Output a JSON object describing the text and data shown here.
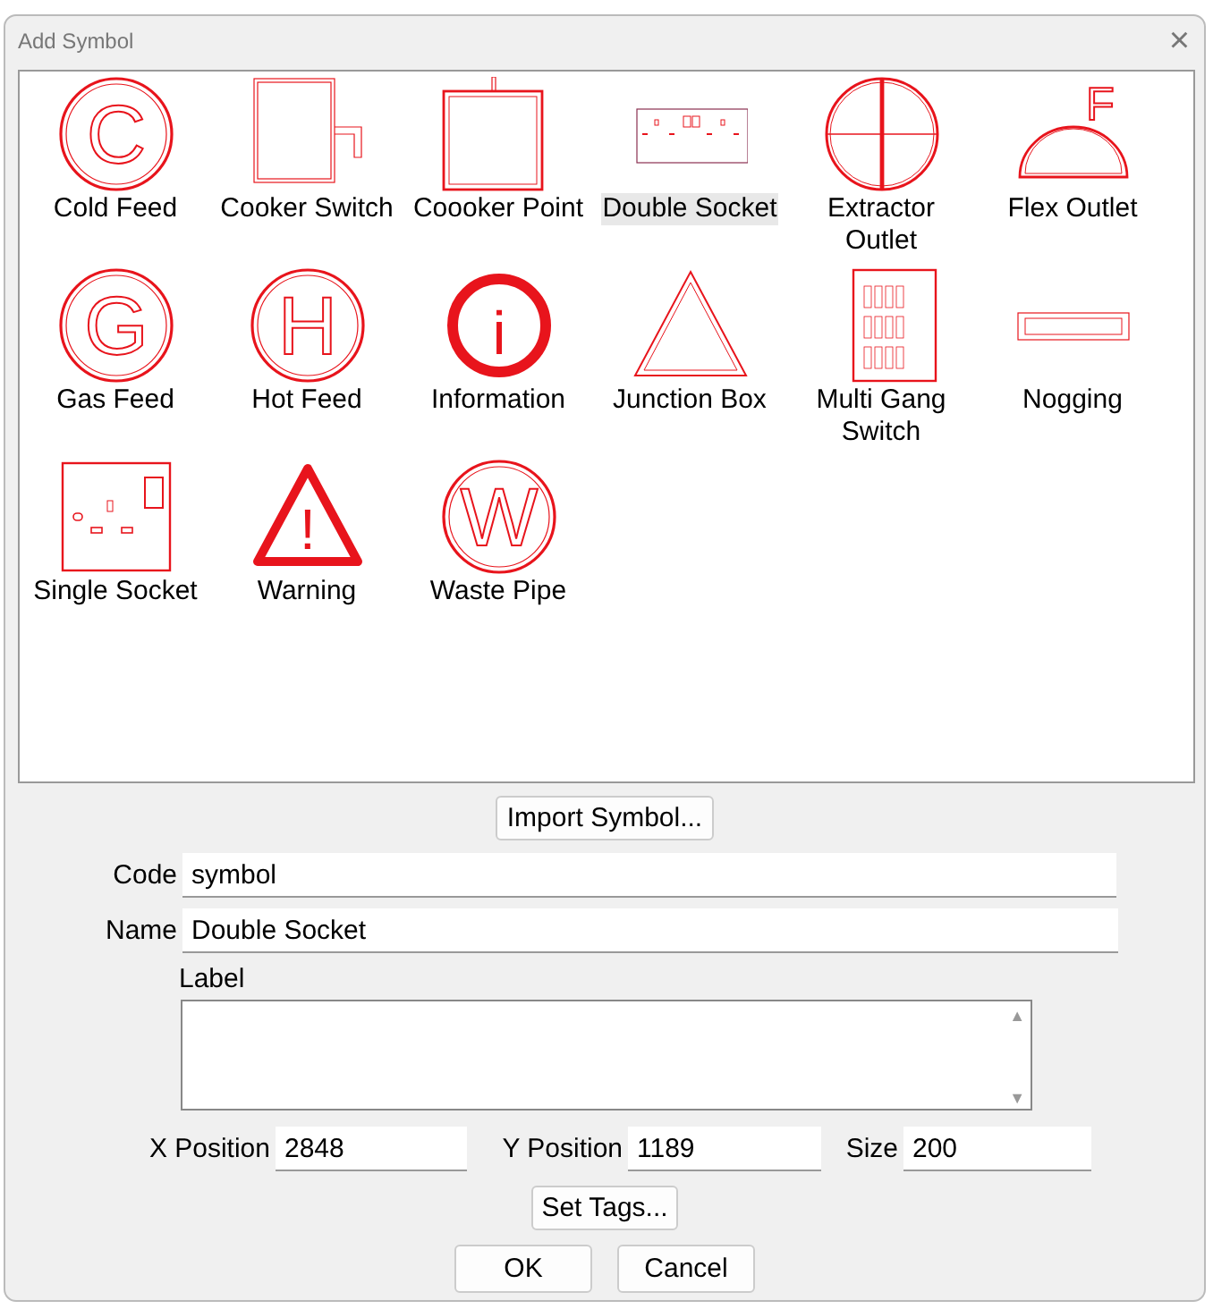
{
  "window": {
    "title": "Add Symbol",
    "close": "×"
  },
  "symbols": [
    {
      "label": "Cold Feed",
      "kind": "letter-circle",
      "letter": "C",
      "selected": false
    },
    {
      "label": "Cooker Switch",
      "kind": "switch-box",
      "selected": false
    },
    {
      "label": "Coooker Point",
      "kind": "point-box",
      "selected": false
    },
    {
      "label": "Double Socket",
      "kind": "double-socket",
      "selected": true
    },
    {
      "label": "Extractor Outlet",
      "kind": "cross-circle",
      "selected": false
    },
    {
      "label": "Flex Outlet",
      "kind": "dome",
      "letter": "F",
      "selected": false
    },
    {
      "label": "Gas Feed",
      "kind": "letter-circle",
      "letter": "G",
      "selected": false
    },
    {
      "label": "Hot Feed",
      "kind": "letter-circle",
      "letter": "H",
      "selected": false
    },
    {
      "label": "Information",
      "kind": "info",
      "letter": "i",
      "selected": false
    },
    {
      "label": "Junction Box",
      "kind": "triangle",
      "selected": false
    },
    {
      "label": "Multi Gang Switch",
      "kind": "multi-gang",
      "selected": false
    },
    {
      "label": "Nogging",
      "kind": "nogging",
      "selected": false
    },
    {
      "label": "Single Socket",
      "kind": "single-socket",
      "selected": false
    },
    {
      "label": "Warning",
      "kind": "warning",
      "letter": "!",
      "selected": false
    },
    {
      "label": "Waste Pipe",
      "kind": "letter-circle",
      "letter": "W",
      "selected": false
    }
  ],
  "import_button": "Import Symbol...",
  "code": {
    "label": "Code",
    "value": "symbol"
  },
  "name": {
    "label": "Name",
    "value": "Double Socket"
  },
  "label_field": {
    "label": "Label",
    "scroll_up": "▲",
    "scroll_down": "▼"
  },
  "x_position": {
    "label": "X Position",
    "value": "2848"
  },
  "y_position": {
    "label": "Y Position",
    "value": "1189"
  },
  "size": {
    "label": "Size",
    "value": "200"
  },
  "set_tags_button": "Set Tags...",
  "buttons": [
    "OK",
    "Cancel"
  ]
}
